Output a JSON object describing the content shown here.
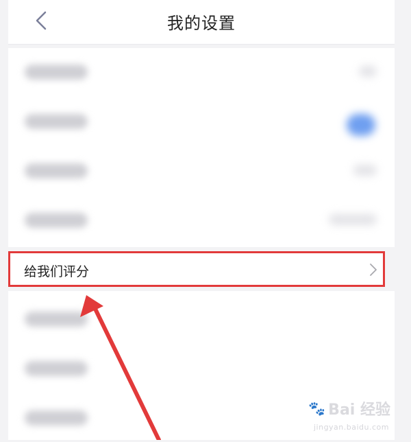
{
  "header": {
    "title": "我的设置",
    "back_icon": "chevron-left-icon"
  },
  "rate_row": {
    "label": "给我们评分",
    "chevron_icon": "chevron-right-icon"
  },
  "watermark": {
    "text": "Bai 经验",
    "subtext": "jingyan.baidu.com"
  },
  "colors": {
    "highlight_border": "#e23a3a",
    "arrow": "#e23a3a"
  }
}
